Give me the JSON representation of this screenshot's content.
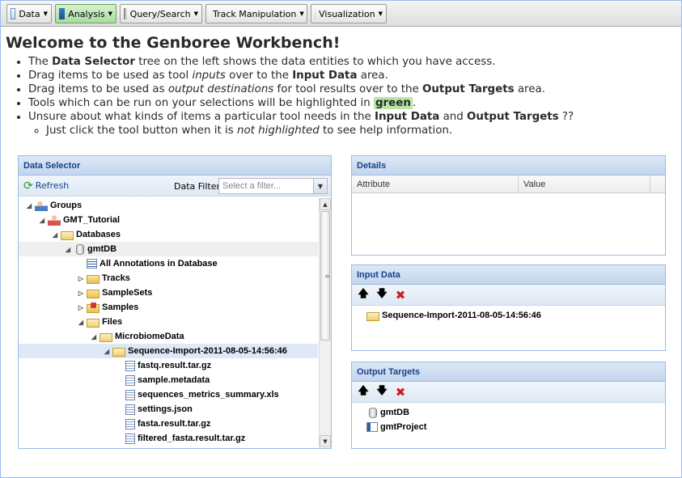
{
  "toolbar": {
    "items": [
      {
        "label": "Data",
        "icon": "data-icon"
      },
      {
        "label": "Analysis",
        "icon": "analysis-icon"
      },
      {
        "label": "Query/Search",
        "icon": "query-icon"
      },
      {
        "label": "Track Manipulation",
        "icon": "track-icon"
      },
      {
        "label": "Visualization",
        "icon": "visualization-icon"
      }
    ]
  },
  "welcome": {
    "title": "Welcome to the Genboree Workbench!",
    "b1_pre": "The ",
    "b1_bold": "Data Selector",
    "b1_post": " tree on the left shows the data entities to which you have access.",
    "b2_pre": "Drag items to be used as tool ",
    "b2_em": "inputs",
    "b2_mid": " over to the ",
    "b2_bold": "Input Data",
    "b2_post": " area.",
    "b3_pre": "Drag items to be used as ",
    "b3_em": "output destinations",
    "b3_mid": " for tool results over to the ",
    "b3_bold": "Output Targets",
    "b3_post": " area.",
    "b4_pre": "Tools which can be run on your selections will be highlighted in ",
    "b4_green": "green",
    "b4_post": ".",
    "b5_pre": "Unsure about what kinds of items a particular tool needs in the ",
    "b5_bold1": "Input Data",
    "b5_mid": " and ",
    "b5_bold2": "Output Targets",
    "b5_post": " ??",
    "b6_pre": "Just click the tool button when it is ",
    "b6_em": "not highlighted",
    "b6_post": " to see help information."
  },
  "data_selector": {
    "title": "Data Selector",
    "refresh_label": "Refresh",
    "filter_label": "Data Filter:",
    "filter_placeholder": "Select a filter...",
    "tree": [
      {
        "label": "Groups",
        "depth": 0,
        "expander": "open",
        "icon": "group"
      },
      {
        "label": "GMT_Tutorial",
        "depth": 1,
        "expander": "open",
        "icon": "person"
      },
      {
        "label": "Databases",
        "depth": 2,
        "expander": "open",
        "icon": "folder-open"
      },
      {
        "label": "gmtDB",
        "depth": 3,
        "expander": "open",
        "icon": "db",
        "state": "hi"
      },
      {
        "label": "All Annotations in Database",
        "depth": 4,
        "expander": "none",
        "icon": "list"
      },
      {
        "label": "Tracks",
        "depth": 4,
        "expander": "closed",
        "icon": "folder"
      },
      {
        "label": "SampleSets",
        "depth": 4,
        "expander": "closed",
        "icon": "folder"
      },
      {
        "label": "Samples",
        "depth": 4,
        "expander": "closed",
        "icon": "samples"
      },
      {
        "label": "Files",
        "depth": 4,
        "expander": "open",
        "icon": "folder-open"
      },
      {
        "label": "MicrobiomeData",
        "depth": 5,
        "expander": "open",
        "icon": "folder-open"
      },
      {
        "label": "Sequence-Import-2011-08-05-14:56:46",
        "depth": 6,
        "expander": "open",
        "icon": "folder-open",
        "state": "sel"
      },
      {
        "label": "fastq.result.tar.gz",
        "depth": 7,
        "expander": "none",
        "icon": "file"
      },
      {
        "label": "sample.metadata",
        "depth": 7,
        "expander": "none",
        "icon": "file"
      },
      {
        "label": "sequences_metrics_summary.xls",
        "depth": 7,
        "expander": "none",
        "icon": "file"
      },
      {
        "label": "settings.json",
        "depth": 7,
        "expander": "none",
        "icon": "file"
      },
      {
        "label": "fasta.result.tar.gz",
        "depth": 7,
        "expander": "none",
        "icon": "file"
      },
      {
        "label": "filtered_fasta.result.tar.gz",
        "depth": 7,
        "expander": "none",
        "icon": "file"
      }
    ]
  },
  "details": {
    "title": "Details",
    "col_attribute": "Attribute",
    "col_value": "Value"
  },
  "input_data": {
    "title": "Input Data",
    "items": [
      {
        "label": "Sequence-Import-2011-08-05-14:56:46",
        "icon": "folder-open"
      }
    ]
  },
  "output_targets": {
    "title": "Output Targets",
    "items": [
      {
        "label": "gmtDB",
        "icon": "db"
      },
      {
        "label": "gmtProject",
        "icon": "project"
      }
    ]
  }
}
